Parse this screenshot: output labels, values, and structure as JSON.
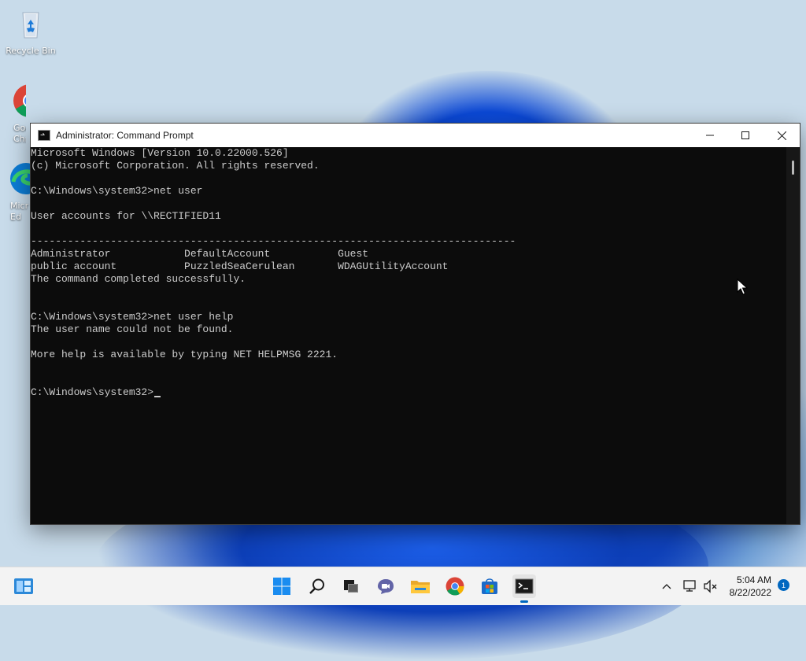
{
  "desktop": {
    "icons": [
      {
        "label": "Recycle Bin"
      },
      {
        "label": "Goo Chro"
      },
      {
        "label": "Micr Ed"
      }
    ]
  },
  "window": {
    "title": "Administrator: Command Prompt",
    "console_lines": [
      "Microsoft Windows [Version 10.0.22000.526]",
      "(c) Microsoft Corporation. All rights reserved.",
      "",
      "C:\\Windows\\system32>net user",
      "",
      "User accounts for \\\\RECTIFIED11",
      "",
      "-------------------------------------------------------------------------------",
      "Administrator            DefaultAccount           Guest",
      "public account           PuzzledSeaCerulean       WDAGUtilityAccount",
      "The command completed successfully.",
      "",
      "",
      "C:\\Windows\\system32>net user help",
      "The user name could not be found.",
      "",
      "More help is available by typing NET HELPMSG 2221.",
      "",
      "",
      "C:\\Windows\\system32>"
    ]
  },
  "taskbar": {
    "time": "5:04 AM",
    "date": "8/22/2022",
    "notification_count": "1"
  },
  "colors": {
    "console_bg": "#0c0c0c",
    "console_text": "#cccccc",
    "accent": "#0067c0"
  }
}
